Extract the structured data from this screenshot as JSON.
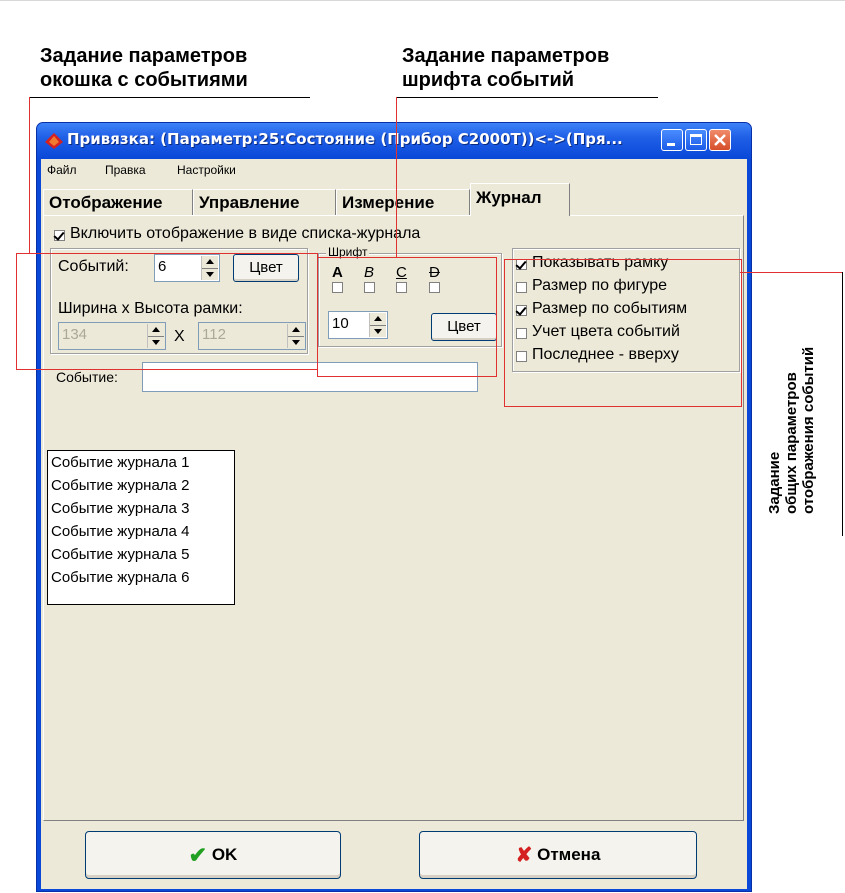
{
  "annotations": {
    "window_params": [
      "Задание параметров",
      "окошка с событиями"
    ],
    "font_params": [
      "Задание параметров",
      "шрифта событий"
    ],
    "general_params": [
      "Задание",
      "общих параметров",
      "отображения событий"
    ]
  },
  "window": {
    "title": "Привязка: (Параметр:25:Состояние (Прибор С2000Т))<->(Пря...",
    "controls": {
      "minimize": "minimize-icon",
      "maximize": "maximize-icon",
      "close": "close-icon"
    }
  },
  "menu": [
    "Файл",
    "Правка",
    "Настройки"
  ],
  "tabs": [
    {
      "label": "Отображение"
    },
    {
      "label": "Управление"
    },
    {
      "label": "Измерение"
    },
    {
      "label": "Журнал"
    }
  ],
  "journal": {
    "enable_label": "Включить отображение в виде списка-журнала",
    "events_label": "Событий:",
    "events_value": "6",
    "color_button": "Цвет",
    "size_label": "Ширина x Высота рамки:",
    "width_value": "134",
    "times": "X",
    "height_value": "112",
    "font_group": "Шрифт",
    "font_styles": [
      "A",
      "B",
      "C",
      "D"
    ],
    "font_size": "10",
    "font_color_button": "Цвет",
    "options": [
      {
        "label": "Показывать рамку",
        "checked": true
      },
      {
        "label": "Размер по фигуре",
        "checked": false
      },
      {
        "label": "Размер по событиям",
        "checked": true
      },
      {
        "label": "Учет цвета событий",
        "checked": false
      },
      {
        "label": "Последнее - вверху",
        "checked": false
      }
    ],
    "event_label": "Событие:",
    "event_value": "",
    "list": [
      "Событие журнала 1",
      "Событие журнала 2",
      "Событие журнала 3",
      "Событие журнала 4",
      "Событие журнала 5",
      "Событие журнала 6"
    ]
  },
  "buttons": {
    "ok": "OK",
    "cancel": "Отмена"
  },
  "colors": {
    "title_blue": "#0a48d8",
    "face": "#ece9d8",
    "annotation_red": "#e03030"
  }
}
